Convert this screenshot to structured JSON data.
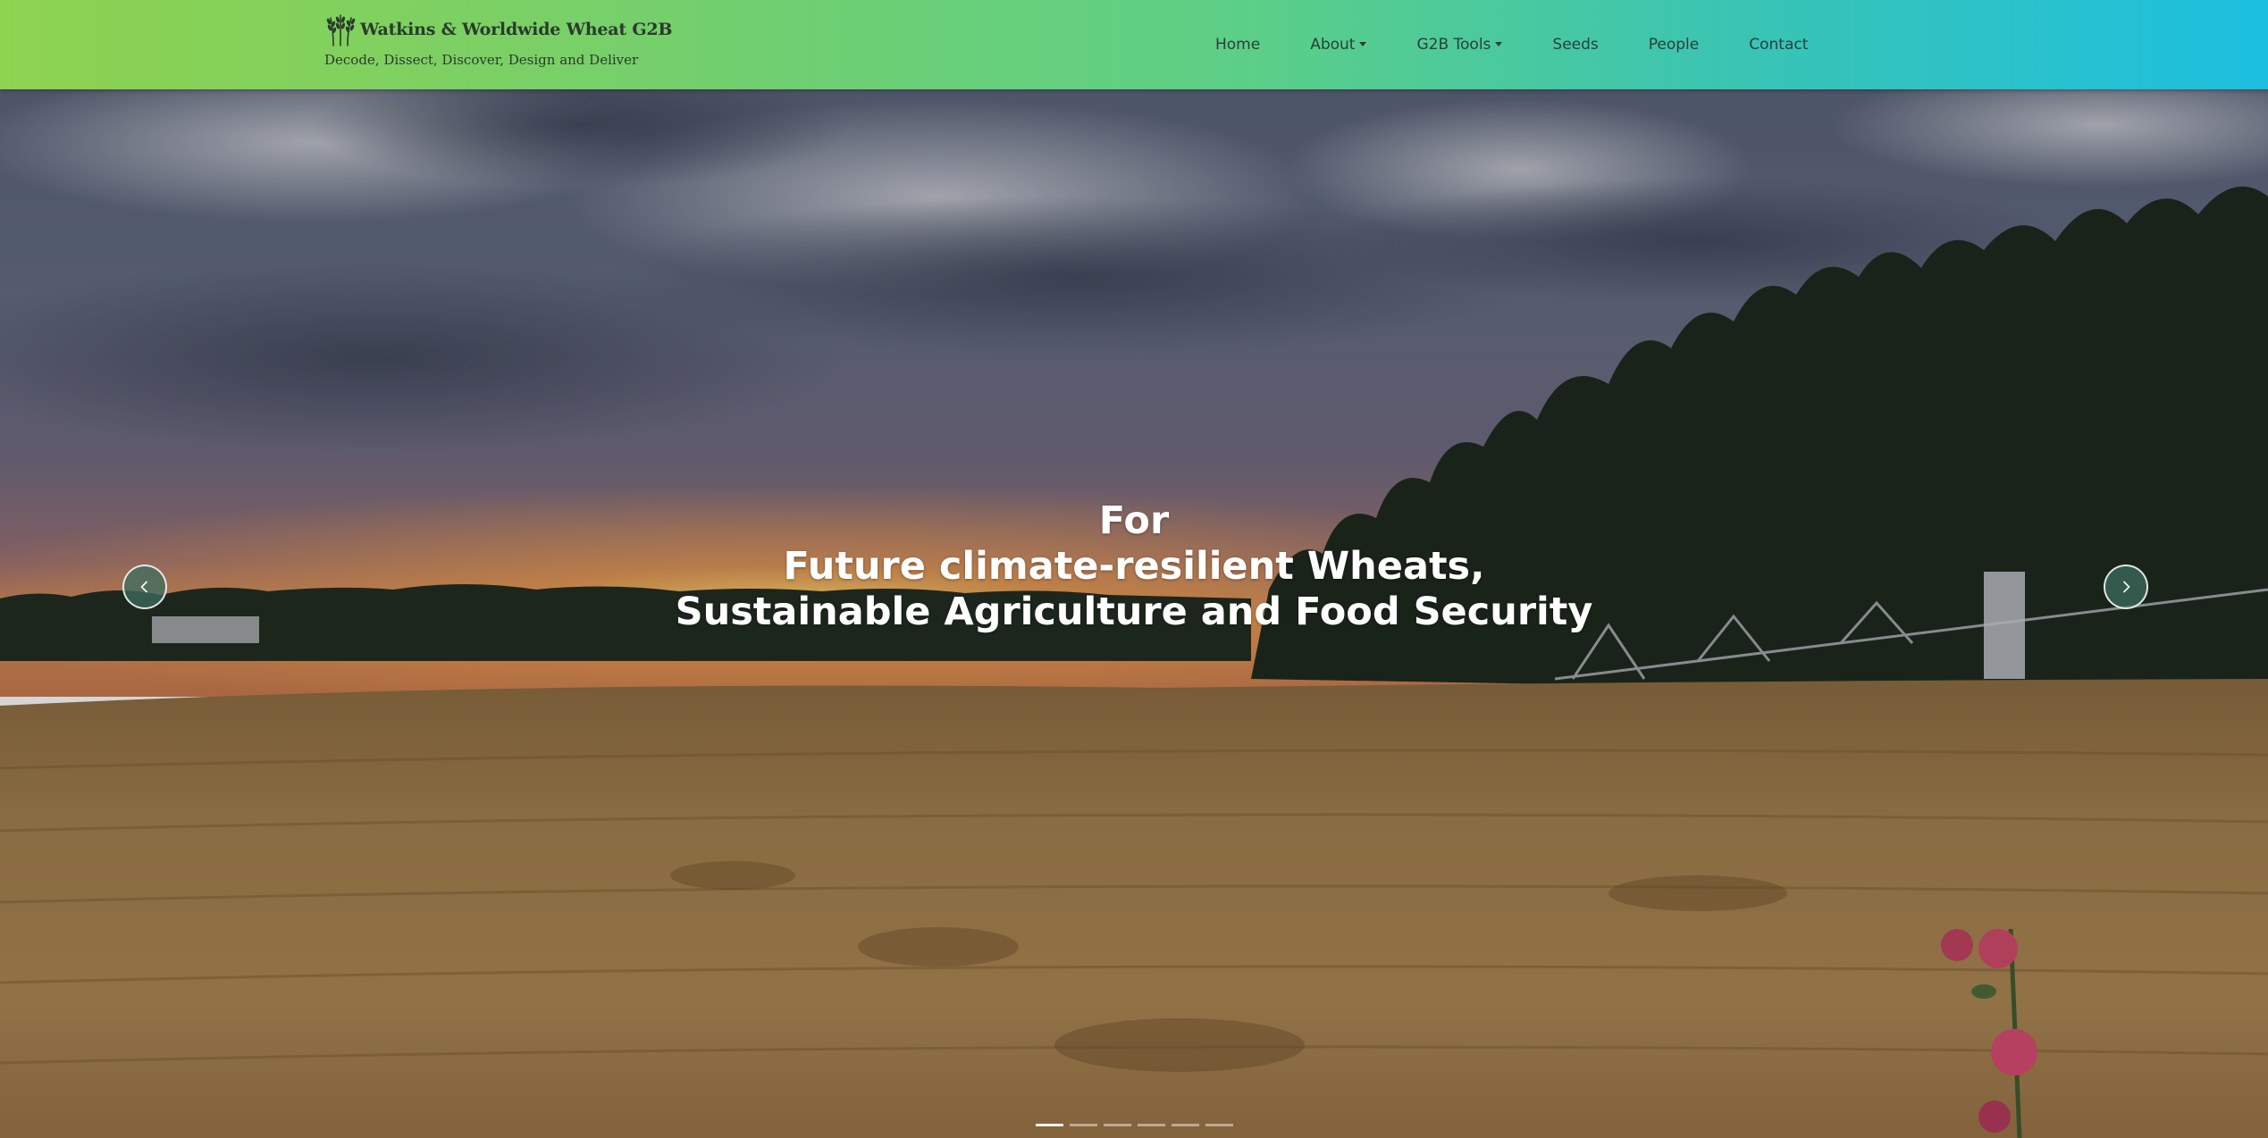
{
  "brand": {
    "title": "Watkins & Worldwide Wheat G2B",
    "tagline": "Decode, Dissect, Discover, Design and Deliver",
    "logo_icon": "wheat-icon"
  },
  "nav": {
    "items": [
      {
        "label": "Home",
        "has_dropdown": false
      },
      {
        "label": "About",
        "has_dropdown": true
      },
      {
        "label": "G2B Tools",
        "has_dropdown": true
      },
      {
        "label": "Seeds",
        "has_dropdown": false
      },
      {
        "label": "People",
        "has_dropdown": false
      },
      {
        "label": "Contact",
        "has_dropdown": false
      }
    ]
  },
  "hero": {
    "caption_lines": [
      "For",
      "Future climate-resilient Wheats,",
      "Sustainable Agriculture and Food Security"
    ],
    "prev_icon": "chevron-left-icon",
    "next_icon": "chevron-right-icon",
    "slide_count": 6,
    "active_slide": 1
  },
  "colors": {
    "header_gradient_start": "#8fd350",
    "header_gradient_end": "#1cbfe0",
    "nav_text": "#2c3e3a",
    "caption_text": "#ffffff"
  }
}
